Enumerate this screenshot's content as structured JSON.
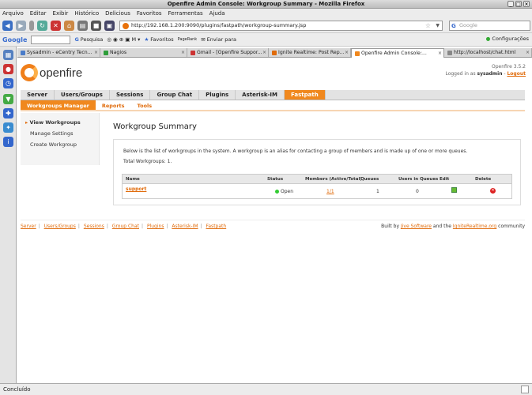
{
  "window": {
    "title": "Openfire Admin Console: Workgroup Summary - Mozilla Firefox"
  },
  "menu": [
    "Arquivo",
    "Editar",
    "Exibir",
    "Histórico",
    "Delicious",
    "Favoritos",
    "Ferramentas",
    "Ajuda"
  ],
  "nav": {
    "url": "http://192.168.1.200:9090/plugins/fastpath/workgroup-summary.jsp",
    "search_placeholder": "Google"
  },
  "google_toolbar": {
    "logo": "Google",
    "search_label": "Pesquisa",
    "favorites_label": "Favoritos",
    "pagerank_label": "PageRank",
    "send_label": "Enviar para",
    "settings_label": "Configurações"
  },
  "tabs": [
    {
      "label": "Sysadmin - eCentry Tecn...",
      "color": "#4a7cc9"
    },
    {
      "label": "Nagios",
      "color": "#2e9e3a"
    },
    {
      "label": "Gmail - [Openfire Suppor...",
      "color": "#c33"
    },
    {
      "label": "Ignite Realtime: Post Rep...",
      "color": "#e06b0b"
    },
    {
      "label": "Openfire Admin Console:...",
      "color": "#f0881e"
    },
    {
      "label": "http://localhost/chat.html",
      "color": "#888"
    }
  ],
  "openfire": {
    "logo": "openfire",
    "version": "Openfire 3.5.2",
    "login_prefix": "Logged in as",
    "user": "sysadmin",
    "logout": "Logout"
  },
  "main_nav": [
    "Server",
    "Users/Groups",
    "Sessions",
    "Group Chat",
    "Plugins",
    "Asterisk-IM",
    "Fastpath"
  ],
  "sub_nav": [
    "Workgroups Manager",
    "Reports",
    "Tools"
  ],
  "left_nav": [
    "View Workgroups",
    "Manage Settings",
    "Create Workgroup"
  ],
  "page": {
    "title": "Workgroup Summary",
    "description": "Below is the list of workgroups in the system. A workgroup is an alias for contacting a group of members and is made up of one or more queues.",
    "total": "Total Workgroups: 1."
  },
  "table": {
    "headers": [
      "Name",
      "Status",
      "Members (Active/Total)",
      "Queues",
      "Users in Queues",
      "Edit",
      "Delete"
    ],
    "rows": [
      {
        "name": "support",
        "status": "Open",
        "members": "1/1",
        "queues": "1",
        "users": "0"
      }
    ]
  },
  "footer": {
    "links": [
      "Server",
      "Users/Groups",
      "Sessions",
      "Group Chat",
      "Plugins",
      "Asterisk-IM",
      "Fastpath"
    ],
    "built_prefix": "Built by",
    "jive": "Jive Software",
    "and_the": "and the",
    "ignite": "IgniteRealtime.org",
    "community": "community"
  },
  "status": {
    "text": "Concluído"
  }
}
